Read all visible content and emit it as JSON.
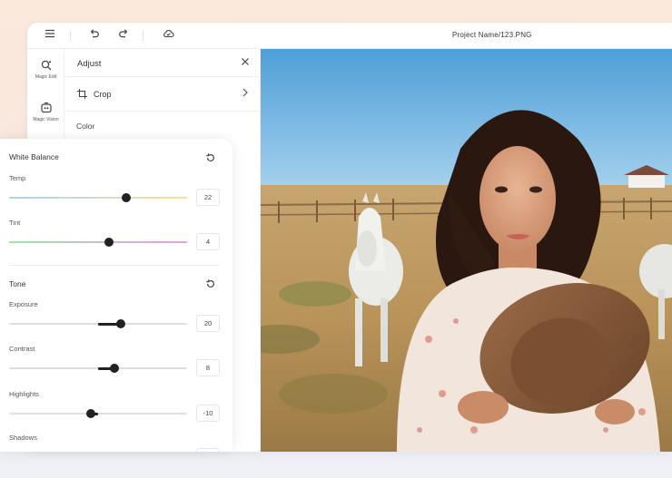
{
  "topbar": {
    "project_name": "Project Name/123.PNG",
    "icons": [
      "menu-icon",
      "undo-icon",
      "redo-icon",
      "cloud-save-icon"
    ]
  },
  "rail": {
    "items": [
      {
        "label": "Magic Edit",
        "icon": "magic-edit-icon"
      },
      {
        "label": "Magic Vision",
        "icon": "magic-vision-icon"
      }
    ]
  },
  "adjust": {
    "title": "Adjust",
    "close_icon": "close-icon",
    "crop_label": "Crop",
    "color_label": "Color"
  },
  "white_balance": {
    "title": "White Balance",
    "temp": {
      "label": "Temp",
      "value": "22",
      "level": 0.66
    },
    "tint": {
      "label": "Tint",
      "value": "4",
      "level": 0.56
    }
  },
  "tone": {
    "title": "Tone",
    "exposure": {
      "label": "Exposure",
      "value": "20",
      "level": 0.63
    },
    "contrast": {
      "label": "Contrast",
      "value": "8",
      "level": 0.59
    },
    "highlights": {
      "label": "Highlights",
      "value": "-10",
      "level": 0.46
    },
    "shadows": {
      "label": "Shadows"
    }
  },
  "colors": {
    "temp_gradient": [
      "#a9d2f5",
      "#f7e39a"
    ],
    "tint_gradient": [
      "#9be7a6",
      "#e99ce9"
    ],
    "knob": "#222222"
  }
}
